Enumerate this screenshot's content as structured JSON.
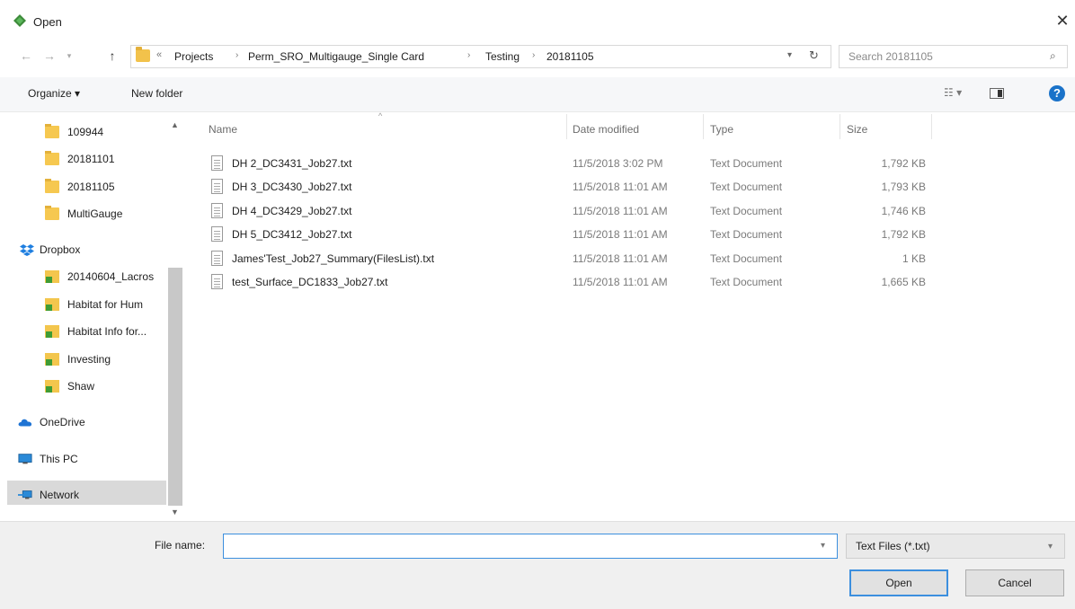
{
  "window": {
    "title": "Open",
    "close_glyph": "✕"
  },
  "address": {
    "breadcrumbs": [
      "Projects",
      "Perm_SRO_Multigauge_Single Card",
      "Testing",
      "20181105"
    ],
    "overflow_glyph": "«",
    "search_placeholder": "Search 20181105"
  },
  "toolbar": {
    "organize_label": "Organize ▾",
    "new_folder_label": "New folder"
  },
  "nav": {
    "items": [
      {
        "label": "109944",
        "icon": "folder-icon"
      },
      {
        "label": "20181101",
        "icon": "folder-icon"
      },
      {
        "label": "20181105",
        "icon": "folder-icon"
      },
      {
        "label": "MultiGauge",
        "icon": "folder-icon"
      },
      {
        "label": "Dropbox",
        "icon": "dropbox-icon"
      },
      {
        "label": "20140604_Lacros",
        "icon": "folder-shortcut-icon"
      },
      {
        "label": "Habitat for Hum",
        "icon": "folder-shortcut-icon"
      },
      {
        "label": "Habitat Info for...",
        "icon": "folder-shortcut-icon"
      },
      {
        "label": "Investing",
        "icon": "folder-shortcut-icon"
      },
      {
        "label": "Shaw",
        "icon": "folder-shortcut-icon"
      },
      {
        "label": "OneDrive",
        "icon": "onedrive-icon"
      },
      {
        "label": "This PC",
        "icon": "pc-icon"
      },
      {
        "label": "Network",
        "icon": "network-icon"
      }
    ]
  },
  "columns": {
    "name": "Name",
    "date": "Date modified",
    "type": "Type",
    "size": "Size"
  },
  "files": [
    {
      "name": "DH 2_DC3431_Job27.txt",
      "date": "11/5/2018 3:02 PM",
      "type": "Text Document",
      "size": "1,792 KB"
    },
    {
      "name": "DH 3_DC3430_Job27.txt",
      "date": "11/5/2018 11:01 AM",
      "type": "Text Document",
      "size": "1,793 KB"
    },
    {
      "name": "DH 4_DC3429_Job27.txt",
      "date": "11/5/2018 11:01 AM",
      "type": "Text Document",
      "size": "1,746 KB"
    },
    {
      "name": "DH 5_DC3412_Job27.txt",
      "date": "11/5/2018 11:01 AM",
      "type": "Text Document",
      "size": "1,792 KB"
    },
    {
      "name": "James'Test_Job27_Summary(FilesList).txt",
      "date": "11/5/2018 11:01 AM",
      "type": "Text Document",
      "size": "1 KB"
    },
    {
      "name": "test_Surface_DC1833_Job27.txt",
      "date": "11/5/2018 11:01 AM",
      "type": "Text Document",
      "size": "1,665 KB"
    }
  ],
  "footer": {
    "file_name_label": "File name:",
    "file_name_value": "",
    "filter_label": "Text Files (*.txt)",
    "open_label": "Open",
    "cancel_label": "Cancel"
  },
  "colors": {
    "accent": "#3c8fde",
    "folder": "#f6c850",
    "help": "#1a72c9"
  }
}
